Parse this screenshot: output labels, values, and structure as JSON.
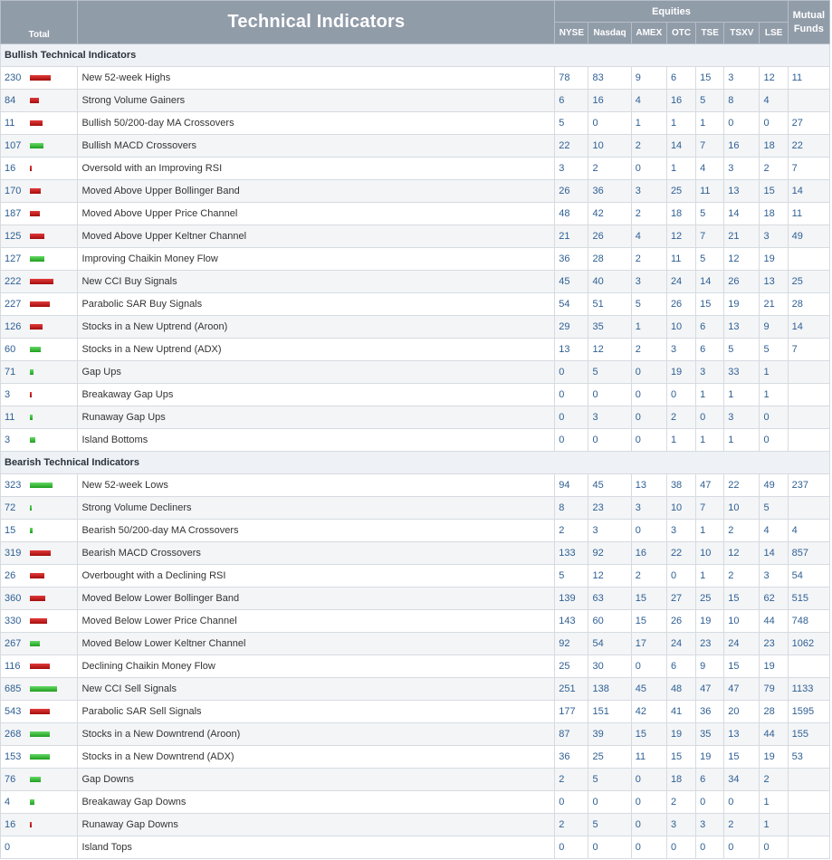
{
  "header": {
    "title": "Technical Indicators",
    "equities_label": "Equities",
    "mutual_funds_label": "Mutual Funds",
    "total_label": "Total",
    "exchanges": [
      "NYSE",
      "Nasdaq",
      "AMEX",
      "OTC",
      "TSE",
      "TSXV",
      "LSE"
    ]
  },
  "colors": {
    "up_bar": "#cc1111",
    "down_bar": "#33bb33",
    "header_bg": "#919ca9"
  },
  "sections": [
    {
      "title": "Bullish Technical Indicators",
      "rows": [
        {
          "total": "230",
          "bar": "red",
          "bar_level": 0.48,
          "name": "New 52-week Highs",
          "values": [
            "78",
            "83",
            "9",
            "6",
            "15",
            "3",
            "12",
            "11"
          ]
        },
        {
          "total": "84",
          "bar": "red",
          "bar_level": 0.2,
          "name": "Strong Volume Gainers",
          "values": [
            "6",
            "16",
            "4",
            "16",
            "5",
            "8",
            "4",
            ""
          ]
        },
        {
          "total": "11",
          "bar": "red",
          "bar_level": 0.3,
          "name": "Bullish 50/200-day MA Crossovers",
          "values": [
            "5",
            "0",
            "1",
            "1",
            "1",
            "0",
            "0",
            "27"
          ]
        },
        {
          "total": "107",
          "bar": "green",
          "bar_level": 0.32,
          "name": "Bullish MACD Crossovers",
          "values": [
            "22",
            "10",
            "2",
            "14",
            "7",
            "16",
            "18",
            "22"
          ]
        },
        {
          "total": "16",
          "bar": "red",
          "bar_level": 0.05,
          "name": "Oversold with an Improving RSI",
          "values": [
            "3",
            "2",
            "0",
            "1",
            "4",
            "3",
            "2",
            "7"
          ]
        },
        {
          "total": "170",
          "bar": "red",
          "bar_level": 0.26,
          "name": "Moved Above Upper Bollinger Band",
          "values": [
            "26",
            "36",
            "3",
            "25",
            "11",
            "13",
            "15",
            "14"
          ]
        },
        {
          "total": "187",
          "bar": "red",
          "bar_level": 0.22,
          "name": "Moved Above Upper Price Channel",
          "values": [
            "48",
            "42",
            "2",
            "18",
            "5",
            "14",
            "18",
            "11"
          ]
        },
        {
          "total": "125",
          "bar": "red",
          "bar_level": 0.33,
          "name": "Moved Above Upper Keltner Channel",
          "values": [
            "21",
            "26",
            "4",
            "12",
            "7",
            "21",
            "3",
            "49"
          ]
        },
        {
          "total": "127",
          "bar": "green",
          "bar_level": 0.34,
          "name": "Improving Chaikin Money Flow",
          "values": [
            "36",
            "28",
            "2",
            "11",
            "5",
            "12",
            "19",
            ""
          ]
        },
        {
          "total": "222",
          "bar": "red",
          "bar_level": 0.55,
          "name": "New CCI Buy Signals",
          "values": [
            "45",
            "40",
            "3",
            "24",
            "14",
            "26",
            "13",
            "25"
          ]
        },
        {
          "total": "227",
          "bar": "red",
          "bar_level": 0.46,
          "name": "Parabolic SAR Buy Signals",
          "values": [
            "54",
            "51",
            "5",
            "26",
            "15",
            "19",
            "21",
            "28"
          ]
        },
        {
          "total": "126",
          "bar": "red",
          "bar_level": 0.3,
          "name": "Stocks in a New Uptrend (Aroon)",
          "values": [
            "29",
            "35",
            "1",
            "10",
            "6",
            "13",
            "9",
            "14"
          ]
        },
        {
          "total": "60",
          "bar": "green",
          "bar_level": 0.26,
          "name": "Stocks in a New Uptrend (ADX)",
          "values": [
            "13",
            "12",
            "2",
            "3",
            "6",
            "5",
            "5",
            "7"
          ]
        },
        {
          "total": "71",
          "bar": "green",
          "bar_level": 0.08,
          "name": "Gap Ups",
          "values": [
            "0",
            "5",
            "0",
            "19",
            "3",
            "33",
            "1",
            ""
          ]
        },
        {
          "total": "3",
          "bar": "red",
          "bar_level": 0.04,
          "name": "Breakaway Gap Ups",
          "values": [
            "0",
            "0",
            "0",
            "0",
            "1",
            "1",
            "1",
            ""
          ]
        },
        {
          "total": "11",
          "bar": "green",
          "bar_level": 0.06,
          "name": "Runaway Gap Ups",
          "values": [
            "0",
            "3",
            "0",
            "2",
            "0",
            "3",
            "0",
            ""
          ]
        },
        {
          "total": "3",
          "bar": "green",
          "bar_level": 0.12,
          "name": "Island Bottoms",
          "values": [
            "0",
            "0",
            "0",
            "1",
            "1",
            "1",
            "0",
            ""
          ]
        }
      ]
    },
    {
      "title": "Bearish Technical Indicators",
      "rows": [
        {
          "total": "323",
          "bar": "green",
          "bar_level": 0.52,
          "name": "New 52-week Lows",
          "values": [
            "94",
            "45",
            "13",
            "38",
            "47",
            "22",
            "49",
            "237"
          ]
        },
        {
          "total": "72",
          "bar": "green",
          "bar_level": 0.04,
          "name": "Strong Volume Decliners",
          "values": [
            "8",
            "23",
            "3",
            "10",
            "7",
            "10",
            "5",
            ""
          ]
        },
        {
          "total": "15",
          "bar": "green",
          "bar_level": 0.06,
          "name": "Bearish 50/200-day MA Crossovers",
          "values": [
            "2",
            "3",
            "0",
            "3",
            "1",
            "2",
            "4",
            "4"
          ]
        },
        {
          "total": "319",
          "bar": "red",
          "bar_level": 0.48,
          "name": "Bearish MACD Crossovers",
          "values": [
            "133",
            "92",
            "16",
            "22",
            "10",
            "12",
            "14",
            "857"
          ]
        },
        {
          "total": "26",
          "bar": "red",
          "bar_level": 0.33,
          "name": "Overbought with a Declining RSI",
          "values": [
            "5",
            "12",
            "2",
            "0",
            "1",
            "2",
            "3",
            "54"
          ]
        },
        {
          "total": "360",
          "bar": "red",
          "bar_level": 0.36,
          "name": "Moved Below Lower Bollinger Band",
          "values": [
            "139",
            "63",
            "15",
            "27",
            "25",
            "15",
            "62",
            "515"
          ]
        },
        {
          "total": "330",
          "bar": "red",
          "bar_level": 0.4,
          "name": "Moved Below Lower Price Channel",
          "values": [
            "143",
            "60",
            "15",
            "26",
            "19",
            "10",
            "44",
            "748"
          ]
        },
        {
          "total": "267",
          "bar": "green",
          "bar_level": 0.22,
          "name": "Moved Below Lower Keltner Channel",
          "values": [
            "92",
            "54",
            "17",
            "24",
            "23",
            "24",
            "23",
            "1062"
          ]
        },
        {
          "total": "116",
          "bar": "red",
          "bar_level": 0.46,
          "name": "Declining Chaikin Money Flow",
          "values": [
            "25",
            "30",
            "0",
            "6",
            "9",
            "15",
            "19",
            ""
          ]
        },
        {
          "total": "685",
          "bar": "green",
          "bar_level": 0.62,
          "name": "New CCI Sell Signals",
          "values": [
            "251",
            "138",
            "45",
            "48",
            "47",
            "47",
            "79",
            "1133"
          ]
        },
        {
          "total": "543",
          "bar": "red",
          "bar_level": 0.45,
          "name": "Parabolic SAR Sell Signals",
          "values": [
            "177",
            "151",
            "42",
            "41",
            "36",
            "20",
            "28",
            "1595"
          ]
        },
        {
          "total": "268",
          "bar": "green",
          "bar_level": 0.46,
          "name": "Stocks in a New Downtrend (Aroon)",
          "values": [
            "87",
            "39",
            "15",
            "19",
            "35",
            "13",
            "44",
            "155"
          ]
        },
        {
          "total": "153",
          "bar": "green",
          "bar_level": 0.45,
          "name": "Stocks in a New Downtrend (ADX)",
          "values": [
            "36",
            "25",
            "11",
            "15",
            "19",
            "15",
            "19",
            "53"
          ]
        },
        {
          "total": "76",
          "bar": "green",
          "bar_level": 0.24,
          "name": "Gap Downs",
          "values": [
            "2",
            "5",
            "0",
            "18",
            "6",
            "34",
            "2",
            ""
          ]
        },
        {
          "total": "4",
          "bar": "green",
          "bar_level": 0.1,
          "name": "Breakaway Gap Downs",
          "values": [
            "0",
            "0",
            "0",
            "2",
            "0",
            "0",
            "1",
            ""
          ]
        },
        {
          "total": "16",
          "bar": "red",
          "bar_level": 0.04,
          "name": "Runaway Gap Downs",
          "values": [
            "2",
            "5",
            "0",
            "3",
            "3",
            "2",
            "1",
            ""
          ]
        },
        {
          "total": "0",
          "bar": "",
          "bar_level": 0,
          "name": "Island Tops",
          "values": [
            "0",
            "0",
            "0",
            "0",
            "0",
            "0",
            "0",
            ""
          ]
        }
      ]
    }
  ]
}
